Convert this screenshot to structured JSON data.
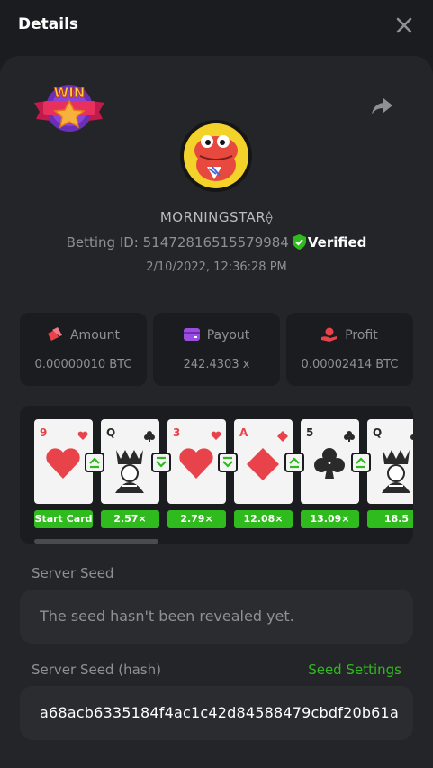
{
  "header": {
    "title": "Details"
  },
  "badge": {
    "text": "WIN"
  },
  "player": {
    "username": "MORNINGSTAR⟠",
    "betting_id_label": "Betting ID:",
    "betting_id": "51472816515579984",
    "verified_label": "Verified",
    "timestamp": "2/10/2022, 12:36:28 PM"
  },
  "stats": {
    "amount": {
      "label": "Amount",
      "value": "0.00000010 BTC"
    },
    "payout": {
      "label": "Payout",
      "value": "242.4303 x"
    },
    "profit": {
      "label": "Profit",
      "value": "0.00002414 BTC"
    }
  },
  "cards": [
    {
      "rank": "9",
      "suit": "heart",
      "multiplier": "Start Card"
    },
    {
      "rank": "Q",
      "suit": "club",
      "multiplier": "2.57×",
      "guess": "higher"
    },
    {
      "rank": "3",
      "suit": "heart",
      "multiplier": "2.79×",
      "guess": "lower"
    },
    {
      "rank": "A",
      "suit": "diamond",
      "multiplier": "12.08×",
      "guess": "lower"
    },
    {
      "rank": "5",
      "suit": "club",
      "multiplier": "13.09×",
      "guess": "higher"
    },
    {
      "rank": "Q",
      "suit": "club",
      "multiplier": "18.5",
      "guess": "higher"
    }
  ],
  "server_seed": {
    "label": "Server Seed",
    "placeholder": "The seed hasn't been revealed yet."
  },
  "server_seed_hash": {
    "label": "Server Seed (hash)",
    "link": "Seed Settings",
    "value": "a68acb6335184f4ac1c42d84588479cbdf20b61a"
  },
  "colors": {
    "accent_green": "#2fba1d",
    "panel": "#242528",
    "background": "#1b1c1f",
    "heart_red": "#e8434a"
  }
}
